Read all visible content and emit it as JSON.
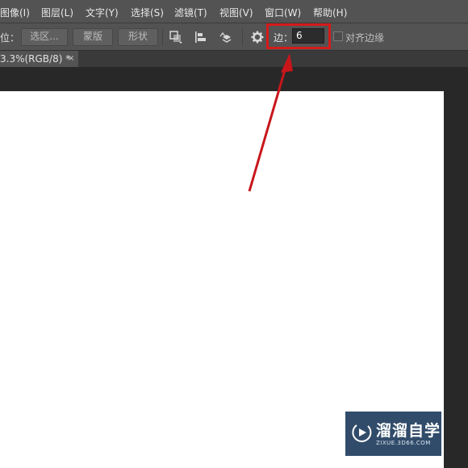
{
  "menu": {
    "items": [
      "图像(I)",
      "图层(L)",
      "文字(Y)",
      "选择(S)",
      "滤镜(T)",
      "视图(V)",
      "窗口(W)",
      "帮助(H)"
    ]
  },
  "options": {
    "prefix_label": "位：",
    "btn_selection": "选区...",
    "btn_mask": "蒙版",
    "btn_shape": "形状",
    "edge_label": "边：",
    "edge_value": "6",
    "align_edges_label": "对齐边缘"
  },
  "tab": {
    "title": "3.3%(RGB/8) *",
    "close": "×"
  },
  "watermark": {
    "name": "溜溜自学",
    "url": "ZIXUE.3D66.COM"
  },
  "colors": {
    "highlight": "#d41a1a",
    "watermark_bg": "#203d5e"
  }
}
